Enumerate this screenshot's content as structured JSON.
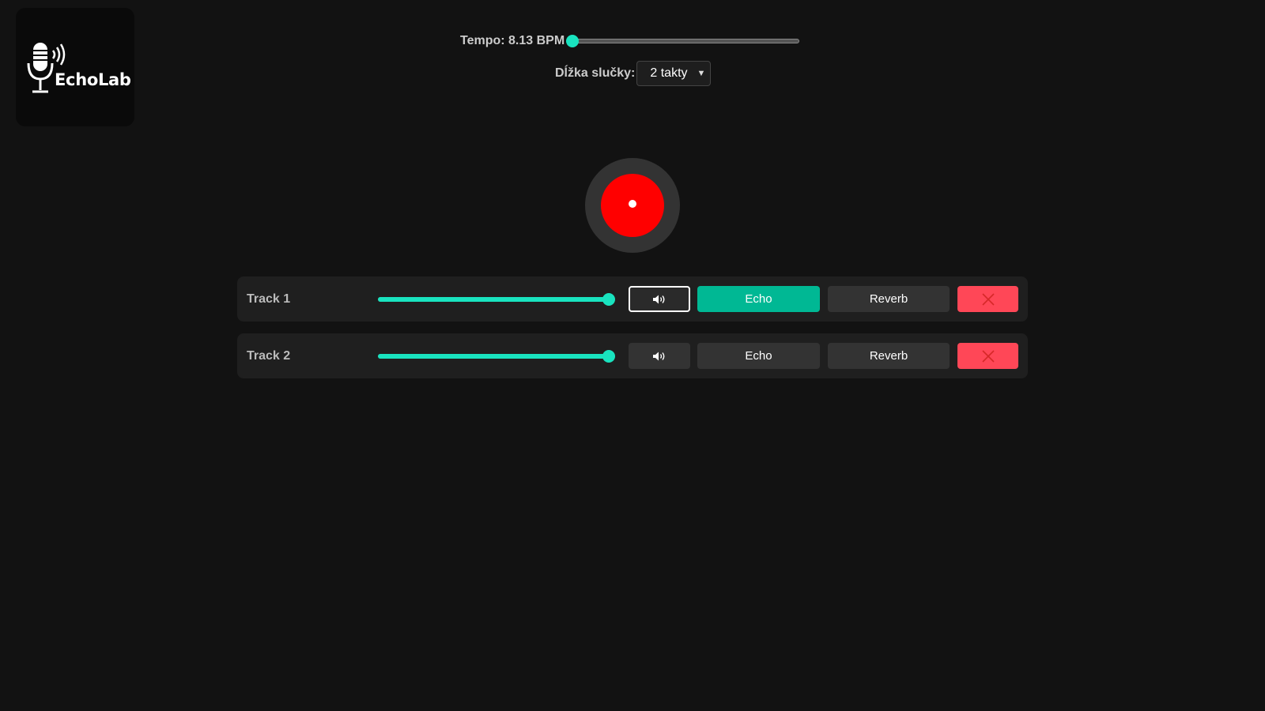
{
  "app": {
    "name": "EchoLab"
  },
  "tempo": {
    "label": "Tempo: 8.13 BPM",
    "fraction": 0.0
  },
  "loop": {
    "label": "Dĺžka slučky:",
    "selected": "2 takty"
  },
  "tracks": [
    {
      "name": "Track 1",
      "volume": 1.0,
      "mute_active": true,
      "echo_label": "Echo",
      "echo_on": true,
      "reverb_label": "Reverb"
    },
    {
      "name": "Track 2",
      "volume": 1.0,
      "mute_active": false,
      "echo_label": "Echo",
      "echo_on": false,
      "reverb_label": "Reverb"
    }
  ],
  "icons": {
    "logo": "microphone-icon",
    "record": "record-icon",
    "mute": "speaker-icon",
    "delete": "close-icon",
    "select": "chevron-down-icon"
  },
  "colors": {
    "accent": "#19e3bf",
    "echo_on": "#00b894",
    "record": "#ff0000",
    "delete": "#ff4757"
  }
}
